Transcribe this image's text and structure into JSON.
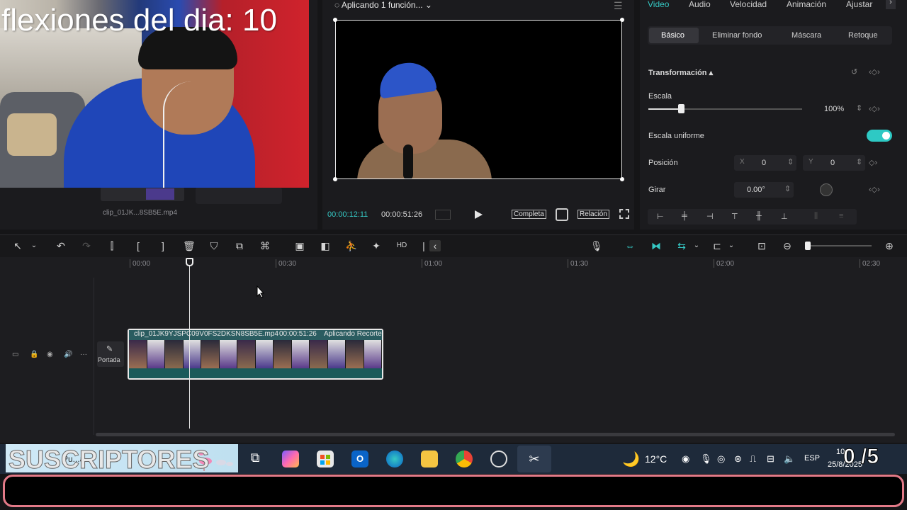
{
  "overlay": {
    "title": "flexiones del dia: 10"
  },
  "media_bin": {
    "clip_name": "clip_01JK...8SB5E.mp4"
  },
  "player": {
    "status": "Aplicando 1 función...",
    "current_time": "00:00:12:11",
    "total_time": "00:00:51:26",
    "completa_label": "Completa",
    "relacion_label": "Relación"
  },
  "properties": {
    "tabs": [
      "Video",
      "Audio",
      "Velocidad",
      "Animación",
      "Ajustar"
    ],
    "subtabs": [
      "Básico",
      "Eliminar fondo",
      "Máscara",
      "Retoque"
    ],
    "section_title": "Transformación",
    "scale_label": "Escala",
    "scale_value": "100%",
    "scale_fraction": 0.21,
    "uniform_scale_label": "Escala uniforme",
    "uniform_scale_on": true,
    "position_label": "Posición",
    "x_label": "X",
    "x_value": "0",
    "y_label": "Y",
    "y_value": "0",
    "rotate_label": "Girar",
    "rotate_value": "0.00°"
  },
  "timeline": {
    "ruler_labels": [
      "00:00",
      "00:30",
      "01:00",
      "01:30",
      "02:00",
      "02:30"
    ],
    "cover_label": "Portada",
    "clip": {
      "name": "clip_01JK9YJSPC09V0FS2DKSN8SB5E.mp4",
      "duration": "00:00:51:26",
      "status": "Aplicando Recorte"
    }
  },
  "taskbar": {
    "banner_text": "SUSCRIPTORES",
    "search_text": "Pu...a",
    "weather": "12°C",
    "language": "ESP",
    "time": "10",
    "date": "25/8/2025",
    "counter": "0 /5"
  },
  "colors": {
    "accent": "#35c8c4",
    "border_pink": "#e37a88"
  }
}
